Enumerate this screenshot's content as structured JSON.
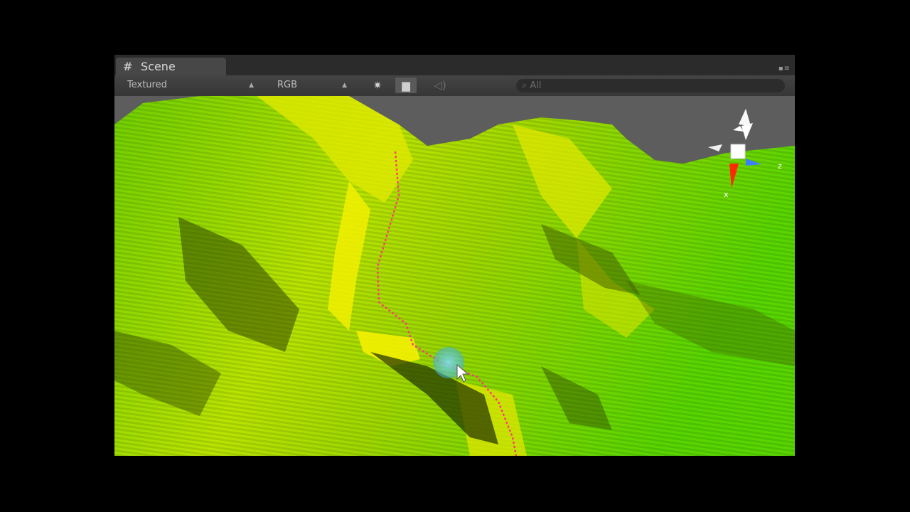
{
  "window": {
    "tab_label": "Scene",
    "menu_glyph": "▪≡"
  },
  "toolbar": {
    "render_mode": "Textured",
    "resolution": "RGB",
    "search_placeholder": "All"
  },
  "gizmo": {
    "x_label": "x",
    "z_label": "z"
  },
  "colors": {
    "terrain_light": "#c8e800",
    "terrain_dark": "#3d5a00",
    "path": "#ff3c78",
    "sky": "#5d5d5d"
  }
}
